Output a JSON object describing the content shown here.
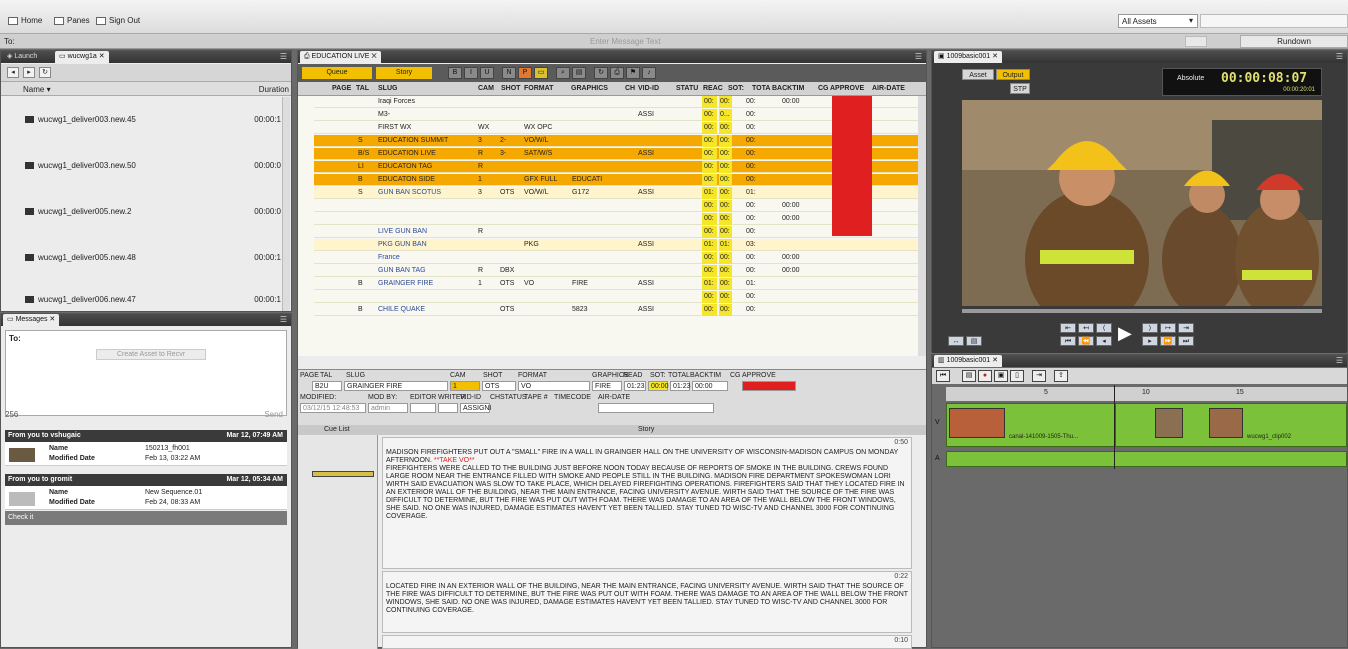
{
  "menubar": {
    "home": "Home",
    "panes": "Panes",
    "signout": "Sign Out",
    "assets": "All Assets"
  },
  "tobar": {
    "to": "To:",
    "message_placeholder": "Enter Message Text",
    "rundown": "Rundown"
  },
  "browser": {
    "tabs": [
      "Launch",
      "wucwg1a"
    ],
    "col_name": "Name",
    "col_duration": "Duration",
    "items": [
      {
        "name": "wucwg1_deliver003.new.45",
        "duration": "00:00:1"
      },
      {
        "name": "wucwg1_deliver003.new.50",
        "duration": "00:00:0"
      },
      {
        "name": "wucwg1_deliver005.new.2",
        "duration": "00:00:0"
      },
      {
        "name": "wucwg1_deliver005.new.48",
        "duration": "00:00:1"
      },
      {
        "name": "wucwg1_deliver006.new.47",
        "duration": "00:00:1"
      }
    ]
  },
  "messages": {
    "tab": "Messages",
    "to": "To:",
    "create": "Create Asset to Recvr",
    "count": "256",
    "send": "Send",
    "list": [
      {
        "header": "From you to vshugaic",
        "date": "Mar 12, 07:49 AM",
        "name_k": "Name",
        "name_v": "150213_fh001",
        "mod_k": "Modified Date",
        "mod_v": "Feb 13, 03:22 AM"
      },
      {
        "header": "From you to gromit",
        "date": "Mar 12, 05:34 AM",
        "name_k": "Name",
        "name_v": "New Sequence.01",
        "mod_k": "Modified Date",
        "mod_v": "Feb 24, 08:33 AM"
      }
    ],
    "check": "Check it"
  },
  "rundown": {
    "tab": "EDUCATION LIVE",
    "queue": "Queue",
    "story": "Story",
    "columns": [
      "PAGE",
      "TAL",
      "SLUG",
      "CAM",
      "SHOT",
      "FORMAT",
      "GRAPHICS",
      "CH",
      "VID-ID",
      "STATU",
      "REAC",
      "SOT:",
      "TOTA",
      "BACKTIM",
      "CG",
      "APPROVE",
      "AIR-DATE"
    ],
    "rows": [
      {
        "page": "",
        "tal": "",
        "slug": "Iraqi Forces",
        "cam": "",
        "shot": "",
        "format": "",
        "graphics": "",
        "vid": "",
        "read": "00:",
        "sot": "00:",
        "tota": "00:",
        "back": "00:00",
        "style": ""
      },
      {
        "page": "",
        "tal": "",
        "slug": "M3-",
        "cam": "",
        "shot": "",
        "format": "",
        "graphics": "",
        "vid": "ASSI",
        "read": "00:",
        "sot": "0...",
        "tota": "00:",
        "back": "",
        "style": ""
      },
      {
        "page": "",
        "tal": "",
        "slug": "FIRST WX",
        "cam": "WX",
        "shot": "",
        "format": "WX OPC",
        "graphics": "",
        "vid": "",
        "read": "00:",
        "sot": "00:",
        "tota": "00:",
        "back": "",
        "style": ""
      },
      {
        "page": "",
        "tal": "S",
        "slug": "EDUCATION SUMMIT",
        "cam": "3",
        "shot": "2-",
        "format": "VO/W/L",
        "graphics": "",
        "vid": "",
        "read": "00:",
        "sot": "00:",
        "tota": "00:",
        "back": "",
        "style": "y"
      },
      {
        "page": "",
        "tal": "B/S",
        "slug": "EDUCATION LIVE",
        "cam": "R",
        "shot": "3-",
        "format": "SAT/W/S",
        "graphics": "",
        "vid": "ASSI",
        "read": "00:",
        "sot": "00:",
        "tota": "00:",
        "back": "",
        "style": "y"
      },
      {
        "page": "",
        "tal": "LI",
        "slug": "EDUCATON TAG",
        "cam": "R",
        "shot": "",
        "format": "",
        "graphics": "",
        "vid": "",
        "read": "00:",
        "sot": "00:",
        "tota": "00:",
        "back": "",
        "style": "y"
      },
      {
        "page": "",
        "tal": "B",
        "slug": "EDUCATON SIDE",
        "cam": "1",
        "shot": "",
        "format": "GFX FULL",
        "graphics": "EDUCATI",
        "vid": "",
        "read": "00:",
        "sot": "00:",
        "tota": "00:",
        "back": "",
        "style": "y"
      },
      {
        "page": "",
        "tal": "S",
        "slug": "GUN BAN SCOTUS",
        "cam": "3",
        "shot": "OTS",
        "format": "VO/W/L",
        "graphics": "G172",
        "vid": "ASSI",
        "read": "01:",
        "sot": "00:",
        "tota": "01:",
        "back": "",
        "style": "lg"
      },
      {
        "page": "",
        "tal": "",
        "slug": "",
        "cam": "",
        "shot": "",
        "format": "",
        "graphics": "",
        "vid": "",
        "read": "00:",
        "sot": "00:",
        "tota": "00:",
        "back": "00:00",
        "style": ""
      },
      {
        "page": "",
        "tal": "",
        "slug": "",
        "cam": "",
        "shot": "",
        "format": "",
        "graphics": "",
        "vid": "",
        "read": "00:",
        "sot": "00:",
        "tota": "00:",
        "back": "00:00",
        "style": ""
      },
      {
        "page": "",
        "tal": "",
        "slug": "LIVE GUN BAN",
        "cam": "R",
        "shot": "",
        "format": "",
        "graphics": "",
        "vid": "",
        "read": "00:",
        "sot": "00:",
        "tota": "00:",
        "back": "",
        "style": ""
      },
      {
        "page": "",
        "tal": "",
        "slug": "PKG GUN BAN",
        "cam": "",
        "shot": "",
        "format": "PKG",
        "graphics": "",
        "vid": "ASSI",
        "read": "01:",
        "sot": "01:",
        "tota": "03:",
        "back": "",
        "style": "lg"
      },
      {
        "page": "",
        "tal": "",
        "slug": "France",
        "cam": "",
        "shot": "",
        "format": "",
        "graphics": "",
        "vid": "",
        "read": "00:",
        "sot": "00:",
        "tota": "00:",
        "back": "00:00",
        "style": ""
      },
      {
        "page": "",
        "tal": "",
        "slug": "GUN BAN TAG",
        "cam": "R",
        "shot": "DBX",
        "format": "",
        "graphics": "",
        "vid": "",
        "read": "00:",
        "sot": "00:",
        "tota": "00:",
        "back": "00:00",
        "style": ""
      },
      {
        "page": "",
        "tal": "B",
        "slug": "GRAINGER FIRE",
        "cam": "1",
        "shot": "OTS",
        "format": "VO",
        "graphics": "FIRE",
        "vid": "ASSI",
        "read": "01:",
        "sot": "00:",
        "tota": "01:",
        "back": "",
        "style": ""
      },
      {
        "page": "",
        "tal": "",
        "slug": "",
        "cam": "",
        "shot": "",
        "format": "",
        "graphics": "",
        "vid": "",
        "read": "00:",
        "sot": "00:",
        "tota": "00:",
        "back": "",
        "style": ""
      },
      {
        "page": "",
        "tal": "B",
        "slug": "CHILE QUAKE",
        "cam": "",
        "shot": "OTS",
        "format": "",
        "graphics": "5823",
        "vid": "ASSI",
        "read": "00:",
        "sot": "00:",
        "tota": "00:",
        "back": "",
        "style": ""
      }
    ],
    "detail": {
      "h1": [
        "PAGE",
        "TAL",
        "SLUG",
        "CAM",
        "SHOT",
        "FORMAT",
        "GRAPHICS",
        "READ",
        "SOT:",
        "TOTAL",
        "BACKTIM",
        "CG",
        "APPROVE"
      ],
      "tal": "B2U",
      "slug": "GRAINGER FIRE",
      "cam": "1",
      "shot": "OTS",
      "format": "VO",
      "graphics": "FIRE",
      "read": "01:23",
      "sot": "00:00",
      "total": "01:23",
      "back": "00:00",
      "h2": [
        "MODIFIED:",
        "MOD BY:",
        "EDITOR",
        "WRITER",
        "VID-ID",
        "CH",
        "STATUS",
        "TAPE #",
        "TIMECODE",
        "AIR-DATE"
      ],
      "modified": "03/12/15 12:48:53",
      "modby": "admin",
      "vid": "ASSIGNI"
    },
    "cue_list": "Cue List",
    "story_hdr": "Story",
    "stories": [
      {
        "time": "0:50",
        "take": "**TAKE VO**",
        "text1": "MADISON FIREFIGHTERS PUT OUT A \"SMALL\" FIRE IN A WALL IN GRAINGER HALL ON THE UNIVERSITY OF WISCONSIN-MADISON CAMPUS ON MONDAY AFTERNOON.",
        "text2": "FIREFIGHTERS WERE CALLED TO THE BUILDING JUST BEFORE NOON TODAY BECAUSE OF REPORTS OF SMOKE IN THE BUILDING. CREWS FOUND LARGE ROOM NEAR THE ENTRANCE FILLED WITH SMOKE AND PEOPLE STILL IN THE BUILDING. MADISON FIRE DEPARTMENT SPOKESWOMAN LORI WIRTH SAID EVACUATION WAS SLOW TO TAKE PLACE, WHICH DELAYED FIREFIGHTING OPERATIONS. FIREFIGHTERS SAID THAT THEY LOCATED FIRE IN AN EXTERIOR WALL OF THE BUILDING, NEAR THE MAIN ENTRANCE, FACING UNIVERSITY AVENUE. WIRTH SAID THAT THE SOURCE OF THE FIRE WAS DIFFICULT TO DETERMINE, BUT THE FIRE WAS PUT OUT WITH FOAM. THERE WAS DAMAGE TO AN AREA OF THE WALL BELOW THE FRONT WINDOWS, SHE SAID. NO ONE WAS INJURED, DAMAGE ESTIMATES HAVEN'T YET BEEN TALLIED. STAY TUNED TO WISC-TV AND CHANNEL 3000 FOR CONTINUING COVERAGE."
      },
      {
        "time": "0:22",
        "text": "LOCATED FIRE IN AN EXTERIOR WALL OF THE BUILDING, NEAR THE MAIN ENTRANCE, FACING UNIVERSITY AVENUE. WIRTH SAID THAT THE SOURCE OF THE FIRE WAS DIFFICULT TO DETERMINE, BUT THE FIRE WAS PUT OUT WITH FOAM. THERE WAS DAMAGE TO AN AREA OF THE WALL BELOW THE FRONT WINDOWS, SHE SAID. NO ONE WAS INJURED, DAMAGE ESTIMATES HAVEN'T YET BEEN TALLIED. STAY TUNED TO WISC-TV AND CHANNEL 3000 FOR CONTINUING COVERAGE."
      },
      {
        "time": "0:10",
        "text": ""
      }
    ]
  },
  "viewer": {
    "tab": "1009basic001",
    "asset": "Asset",
    "output": "Output",
    "stp": "STP",
    "absolute": "Absolute",
    "timecode": "00:00:08:07",
    "sub_tc": "00:00:20:01"
  },
  "timeline": {
    "tab": "1009basic001",
    "ruler": [
      "5",
      "10",
      "15"
    ],
    "clip1": "canal-141009-1505-Thu...",
    "clip2": "wucwg1_clip002",
    "v": "V",
    "a": "A"
  }
}
